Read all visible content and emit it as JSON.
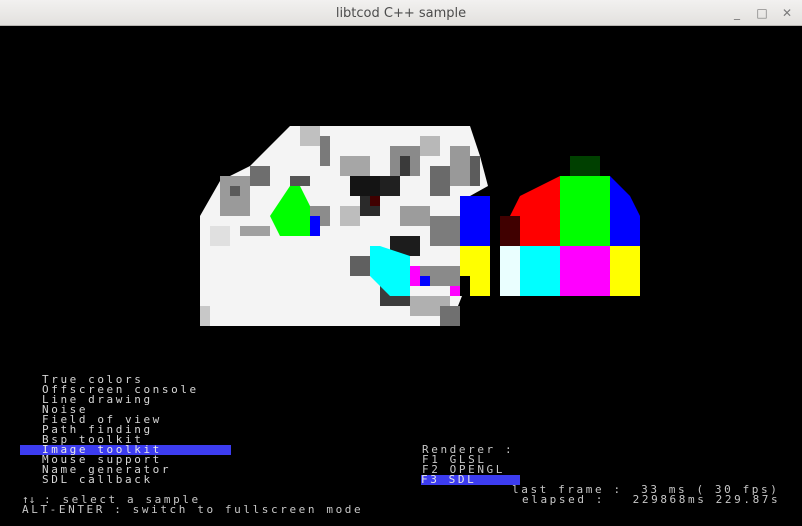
{
  "window": {
    "title": "libtcod C++ sample"
  },
  "window_controls": {
    "minimize": "_",
    "maximize": "□",
    "close": "✕"
  },
  "menu": {
    "items": [
      "True colors",
      "Offscreen console",
      "Line drawing",
      "Noise",
      "Field of view",
      "Path finding",
      "Bsp toolkit",
      "Image toolkit",
      "Mouse support",
      "Name generator",
      "SDL callback"
    ],
    "selected": "Image toolkit"
  },
  "renderer": {
    "header": "Renderer :",
    "options": [
      "F1 GLSL",
      "F2 OPENGL",
      "F3 SDL"
    ],
    "selected": "F3 SDL"
  },
  "stats": {
    "last_frame": "last frame :  33 ms ( 30 fps)",
    "elapsed": "elapsed :   229868ms 229.87s"
  },
  "help": {
    "select_sample": ": select a sample",
    "fullscreen": "ALT-ENTER : switch to fullscreen mode"
  },
  "image_colors": {
    "green": "#00ff00",
    "cyan": "#00ffff",
    "blue": "#0000ff",
    "yellow": "#ffff00",
    "red": "#ff0000",
    "magenta": "#ff00ff",
    "dark_green": "#004000"
  }
}
